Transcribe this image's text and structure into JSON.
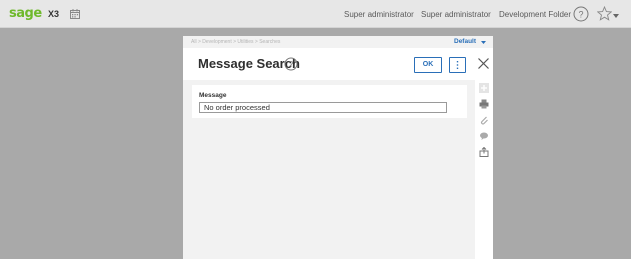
{
  "topbar": {
    "logo": "sage",
    "product": "X3",
    "calendar_icon": "calendar-icon",
    "items": [
      "Super administrator",
      "Super administrator",
      "Development Folder"
    ],
    "help_icon": "help-icon",
    "favorites_icon": "star-icon",
    "menu_caret_icon": "caret-down-icon"
  },
  "dialog": {
    "breadcrumb": "All  >  Development  >  Utilities  >  Searches",
    "view_selector": "Default",
    "title": "Message Search",
    "ok_label": "OK",
    "more_icon": "more-vertical-icon",
    "close_icon": "close-icon",
    "help_icon": "help-icon",
    "field": {
      "label": "Message",
      "value": "No order processed"
    },
    "side_icons": [
      "plus-icon",
      "print-icon",
      "attachment-icon",
      "comment-icon",
      "export-icon"
    ]
  },
  "colors": {
    "brand_green": "#6fb92c",
    "accent_blue": "#2a6fb8",
    "overlay": "#a9a9a9"
  }
}
